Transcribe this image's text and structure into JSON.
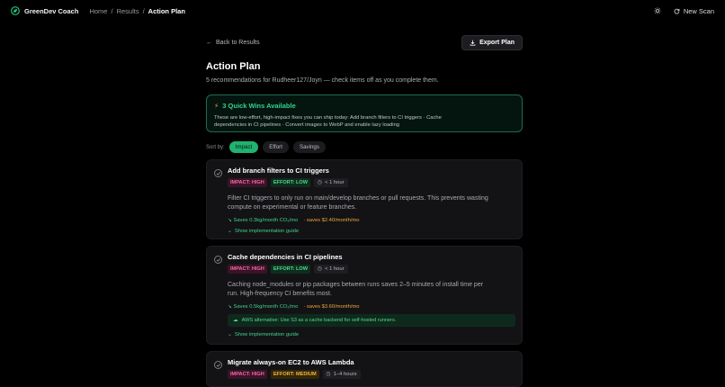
{
  "header": {
    "app_name": "GreenDev Coach",
    "breadcrumb": [
      "Home",
      "Results",
      "Action Plan"
    ],
    "breadcrumb_sep": "/",
    "theme_icon": "sun-icon",
    "new_scan_label": "New Scan"
  },
  "toolbar": {
    "back_label": "Back to Results",
    "export_label": "Export Plan"
  },
  "page": {
    "title": "Action Plan",
    "subtitle": "5 recommendations for Rudheer127/Joyn — check items off as you complete them."
  },
  "quick_wins": {
    "title": "3 Quick Wins Available",
    "body": "These are low-effort, high-impact fixes you can ship today: Add branch filters to CI triggers · Cache dependencies in CI pipelines · Convert images to WebP and enable lazy loading"
  },
  "sort": {
    "label": "Sort by:",
    "options": [
      "Impact",
      "Effort",
      "Savings"
    ],
    "active": "Impact"
  },
  "cards": [
    {
      "title": "Add branch filters to CI triggers",
      "impact": "IMPACT: HIGH",
      "effort": "EFFORT: LOW",
      "time": "< 1 hour",
      "description": "Filter CI triggers to only run on main/develop branches or pull requests. This prevents wasting compute on experimental or feature branches.",
      "co2": "Saves 0.3kg/month CO₂/mo",
      "money": "· saves $2.40/month/mo",
      "guide": "Show implementation guide"
    },
    {
      "title": "Cache dependencies in CI pipelines",
      "impact": "IMPACT: HIGH",
      "effort": "EFFORT: LOW",
      "time": "< 1 hour",
      "description": "Caching node_modules or pip packages between runs saves 2–5 minutes of install time per run. High-frequency CI benefits most.",
      "co2": "Saves 0.5kg/month CO₂/mo",
      "money": "· saves $3.60/month/mo",
      "aws": "AWS alternative: Use S3 as a cache backend for self-hosted runners.",
      "guide": "Show implementation guide"
    },
    {
      "title": "Migrate always-on EC2 to AWS Lambda",
      "impact": "IMPACT: HIGH",
      "effort": "EFFORT: MEDIUM",
      "time": "1–4 hours"
    }
  ],
  "colors": {
    "accent": "#20b26f",
    "bg": "#000000",
    "card": "#131316"
  }
}
